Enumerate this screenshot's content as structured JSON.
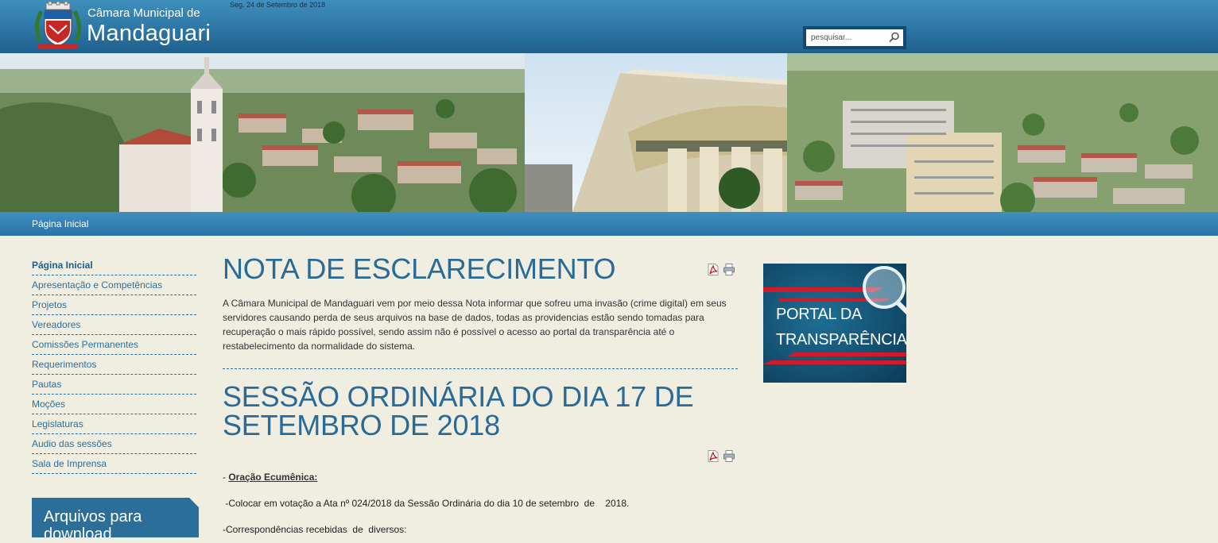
{
  "header": {
    "title_small": "Câmara Municipal de",
    "title_big": "Mandaguari",
    "date": "Seg. 24 de Setembro de 2018",
    "search_placeholder": "pesquisar..."
  },
  "navbar": {
    "home_label": "Página Inicial"
  },
  "sidebar": {
    "items": [
      {
        "label": "Página Inicial"
      },
      {
        "label": "Apresentação e Competências"
      },
      {
        "label": "Projetos"
      },
      {
        "label": "Vereadores"
      },
      {
        "label": "Comissões Permanentes"
      },
      {
        "label": "Requerimentos"
      },
      {
        "label": "Pautas"
      },
      {
        "label": "Moções"
      },
      {
        "label": "Legislaturas"
      },
      {
        "label": "Audio das sessões"
      },
      {
        "label": "Sala de Imprensa"
      }
    ],
    "downloads_title": "Arquivos para download"
  },
  "articles": [
    {
      "title": "NOTA DE ESCLARECIMENTO",
      "body": "A Câmara Municipal de Mandaguari vem por meio dessa Nota informar que sofreu uma invasão (crime digital) em seus servidores causando perda de seus arquivos na base de dados, todas as providencias estão sendo tomadas para recuperação o mais rápido possível, sendo assim não é possível o acesso ao portal da transparência até o restabelecimento da normalidade do sistema."
    },
    {
      "title": "SESSÃO ORDINÁRIA DO DIA 17 DE SETEMBRO DE 2018",
      "line1_prefix": "- ",
      "line1_label": "Oração Ecumênica:",
      "line2": " -Colocar em votação a Ata nº 024/2018 da Sessão Ordinária do dia 10 de setembro  de    2018.",
      "line3": "-Correspondências recebidas  de  diversos:"
    }
  ],
  "promo": {
    "line1": "PORTAL DA",
    "line2": "TRANSPARÊNCIA"
  },
  "icons": {
    "pdf": "pdf-icon",
    "print": "print-icon",
    "search": "search-icon",
    "magnifier": "magnifier-icon"
  },
  "colors": {
    "header": "#2c76a5",
    "link": "#2e6f9d",
    "title": "#2a6a98",
    "background": "#efeee0",
    "promo_bg": "#0f4a6b",
    "promo_stripe": "#c8102e"
  }
}
